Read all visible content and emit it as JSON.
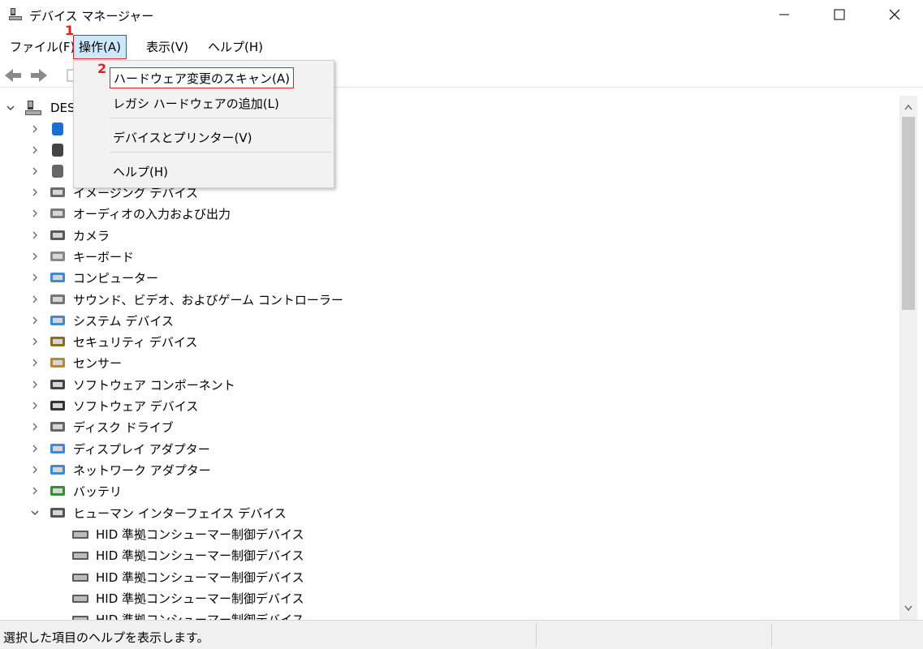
{
  "window": {
    "title": "デバイス マネージャー"
  },
  "menubar": {
    "items": [
      "ファイル(F)",
      "操作(A)",
      "表示(V)",
      "ヘルプ(H)"
    ],
    "active_index": 1
  },
  "callouts": [
    "1",
    "2"
  ],
  "dropdown": {
    "items": [
      "ハードウェア変更のスキャン(A)",
      "レガシ ハードウェアの追加(L)",
      "デバイスとプリンター(V)",
      "ヘルプ(H)"
    ],
    "highlighted_index": 0
  },
  "tree": {
    "root_label": "DES",
    "categories": [
      "イメージング デバイス",
      "オーディオの入力および出力",
      "カメラ",
      "キーボード",
      "コンピューター",
      "サウンド、ビデオ、およびゲーム コントローラー",
      "システム デバイス",
      "セキュリティ デバイス",
      "センサー",
      "ソフトウェア コンポーネント",
      "ソフトウェア デバイス",
      "ディスク ドライブ",
      "ディスプレイ アダプター",
      "ネットワーク アダプター",
      "バッテリ",
      "ヒューマン インターフェイス デバイス"
    ],
    "hid_children": [
      "HID 準拠コンシューマー制御デバイス",
      "HID 準拠コンシューマー制御デバイス",
      "HID 準拠コンシューマー制御デバイス",
      "HID 準拠コンシューマー制御デバイス",
      "HID 準拠コンシューマー制御デバイス"
    ]
  },
  "icons": {
    "app": "device-manager-icon",
    "back": "back-arrow-icon",
    "forward": "forward-arrow-icon"
  },
  "status": {
    "text": "選択した項目のヘルプを表示します。"
  },
  "colors": {
    "accent_red": "#e02020",
    "menu_highlight": "#cce8ff"
  }
}
